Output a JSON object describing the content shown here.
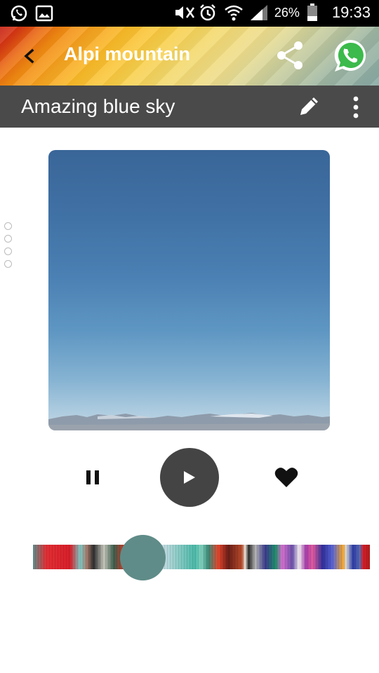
{
  "status_bar": {
    "battery_percent": "26%",
    "time": "19:33",
    "icons": [
      "whatsapp-notification-icon",
      "gallery-notification-icon",
      "vibrate-mute-icon",
      "alarm-icon",
      "wifi-icon",
      "signal-icon",
      "battery-icon"
    ]
  },
  "app_bar": {
    "title": "Alpi mountain",
    "back_icon": "back-arrow-icon",
    "share_icon": "share-icon",
    "whatsapp_icon": "whatsapp-icon"
  },
  "sub_header": {
    "title": "Amazing blue sky",
    "edit_icon": "pencil-icon",
    "more_icon": "more-vertical-icon"
  },
  "player": {
    "pause_icon": "pause-icon",
    "play_icon": "play-icon",
    "like_icon": "heart-icon",
    "seek_progress": 0.33
  },
  "page_indicator": {
    "count": 4
  },
  "colors": {
    "subbar": "#4a4a4a",
    "play_button": "#444444",
    "seek_thumb": "#5f8c88"
  }
}
